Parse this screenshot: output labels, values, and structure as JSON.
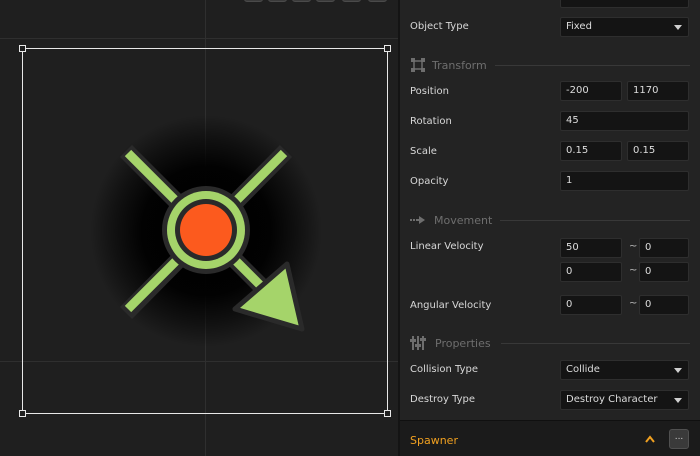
{
  "inspector": {
    "top_partial_value": "",
    "object_type": {
      "label": "Object Type",
      "value": "Fixed"
    },
    "sections": {
      "transform": "Transform",
      "movement": "Movement",
      "properties": "Properties"
    },
    "position": {
      "label": "Position",
      "x": "-200",
      "y": "1170"
    },
    "rotation": {
      "label": "Rotation",
      "value": "45"
    },
    "scale": {
      "label": "Scale",
      "x": "0.15",
      "y": "0.15"
    },
    "opacity": {
      "label": "Opacity",
      "value": "1"
    },
    "linear_velocity": {
      "label": "Linear Velocity",
      "x_min": "50",
      "x_max": "0",
      "y_min": "0",
      "y_max": "0"
    },
    "angular_velocity": {
      "label": "Angular Velocity",
      "min": "0",
      "max": "0"
    },
    "range_separator": "~",
    "collision_type": {
      "label": "Collision Type",
      "value": "Collide"
    },
    "destroy_type": {
      "label": "Destroy Type",
      "value": "Destroy Character"
    },
    "spawner": {
      "title": "Spawner",
      "more_label": "..."
    }
  },
  "colors": {
    "accent": "#f0a020",
    "sprite_green": "#a5d46a",
    "sprite_orange": "#fc5a1e",
    "sprite_outline": "#2a2a2a"
  },
  "icons": {
    "transform": "move-arrows-icon",
    "movement": "motion-arrow-icon",
    "properties": "sliders-icon",
    "collapse": "chevron-up-icon"
  }
}
